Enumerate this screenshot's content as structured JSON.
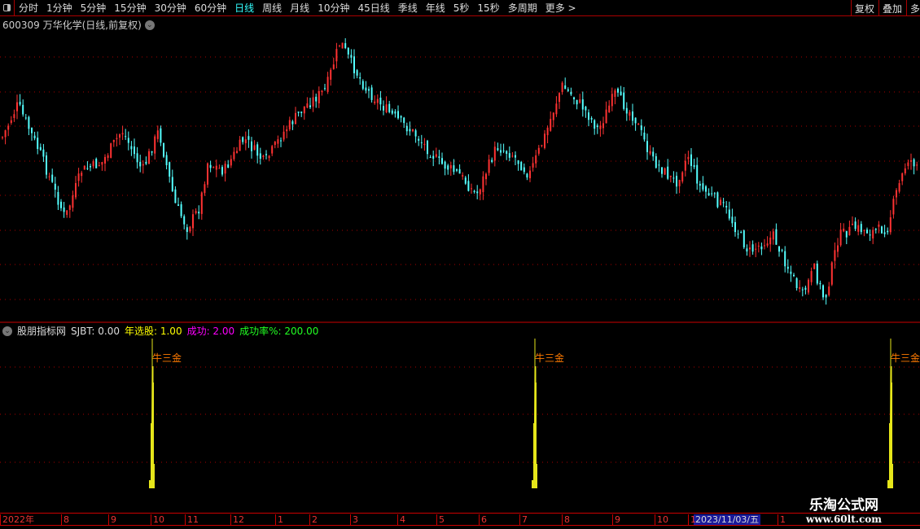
{
  "toolbar": {
    "items": [
      "分时",
      "1分钟",
      "5分钟",
      "15分钟",
      "30分钟",
      "60分钟",
      "日线",
      "周线",
      "月线",
      "10分钟",
      "45日线",
      "季线",
      "年线",
      "5秒",
      "15秒",
      "多周期",
      "更多 >"
    ],
    "active": "日线",
    "right": [
      "复权",
      "叠加",
      "多"
    ]
  },
  "chart": {
    "title": "600309 万华化学(日线,前复权)",
    "up_color": "#ff3232",
    "down_color": "#54ffff"
  },
  "indicator": {
    "name": "股朋指标网",
    "sjbt": "SJBT: 0.00",
    "nianxuangu": "年选股: 1.00",
    "chenggong": "成功: 2.00",
    "chenggonglv": "成功率%: 200.00",
    "signal_label": "牛三金",
    "signal_color": "#e6e61a"
  },
  "axis": {
    "labels": [
      "2022年",
      "8",
      "9",
      "10",
      "11",
      "12",
      "1",
      "2",
      "3",
      "4",
      "5",
      "6",
      "7",
      "8",
      "9",
      "10",
      "1",
      "1"
    ],
    "cursor_date": "2023/11/03/五"
  },
  "watermark": {
    "line1": "乐淘公式网",
    "line2": "www.60lt.com"
  }
}
